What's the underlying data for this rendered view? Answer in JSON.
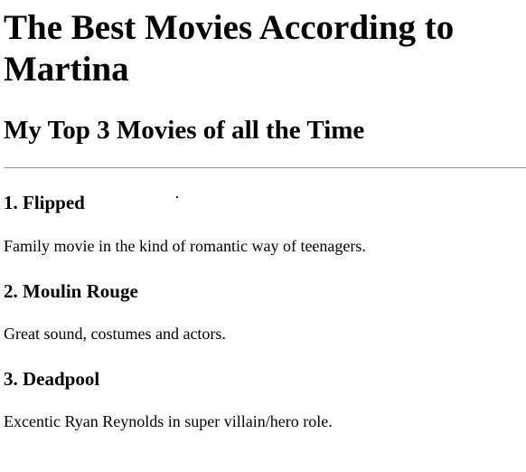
{
  "page": {
    "title": "The Best Movies According to Martina",
    "subtitle": "My Top 3 Movies of all the Time"
  },
  "movies": [
    {
      "title": "1. Flipped",
      "description": "Family movie in the kind of romantic way of teenagers."
    },
    {
      "title": "2. Moulin Rouge",
      "description": "Great sound, costumes and actors."
    },
    {
      "title": "3. Deadpool",
      "description": "Excentic Ryan Reynolds in super villain/hero role."
    }
  ]
}
